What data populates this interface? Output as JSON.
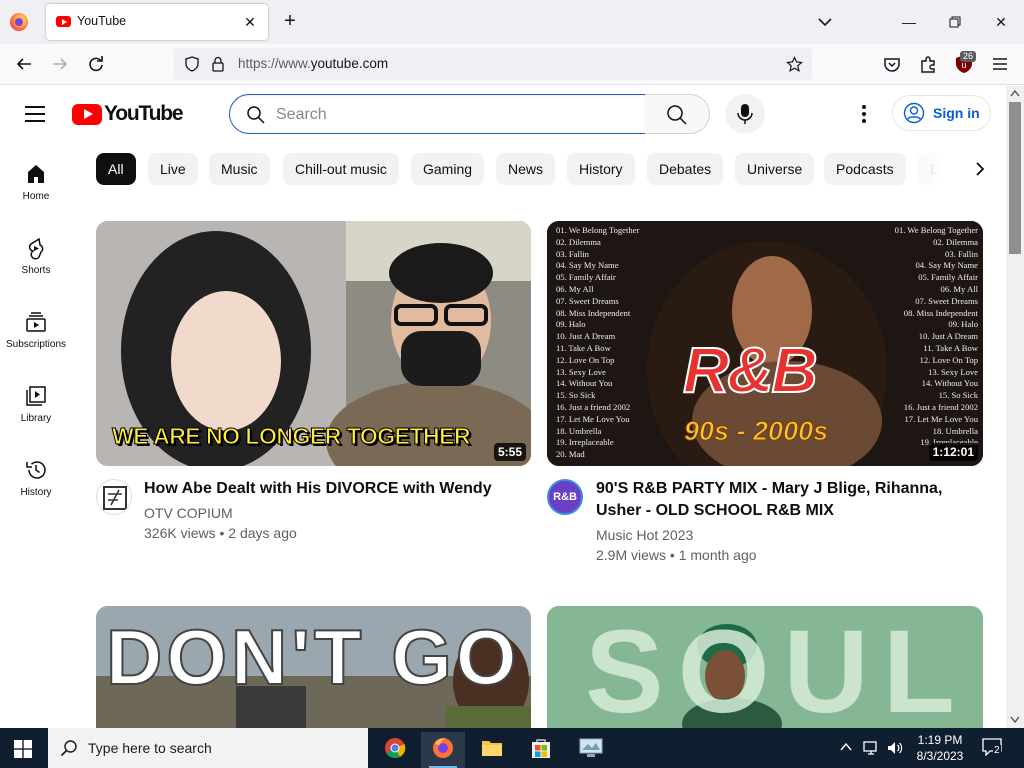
{
  "browser": {
    "tab_title": "YouTube",
    "url_prefix": "https://www.",
    "url_host": "youtube.com",
    "extension_badge": "26"
  },
  "youtube": {
    "logo_text": "YouTube",
    "search_placeholder": "Search",
    "signin_label": "Sign in",
    "chips": [
      "All",
      "Live",
      "Music",
      "Chill-out music",
      "Gaming",
      "News",
      "History",
      "Debates",
      "Universe",
      "Podcasts",
      "D"
    ],
    "guide": [
      "Home",
      "Shorts",
      "Subscriptions",
      "Library",
      "History"
    ],
    "videos": [
      {
        "title": "How Abe Dealt with His DIVORCE with Wendy",
        "channel": "OTV COPIUM",
        "meta": "326K views • 2 days ago",
        "duration": "5:55",
        "thumb_caption": "WE ARE NO LONGER TOGETHER"
      },
      {
        "title_line1": "90'S R&B PARTY MIX - Mary J Blige, Rihanna,",
        "title_line2": "Usher - OLD SCHOOL R&B MIX",
        "channel": "Music Hot 2023",
        "meta": "2.9M views • 1 month ago",
        "duration": "1:12:01",
        "avatar_text": "R&B",
        "thumb_big": "R&B",
        "thumb_sub": "90s - 2000s",
        "tracklist": [
          "01. We Belong Together",
          "02. Dilemma",
          "03. Fallin",
          "04. Say My Name",
          "05. Family Affair",
          "06. My All",
          "07. Sweet Dreams",
          "08. Miss Independent",
          "09. Halo",
          "10. Just A Dream",
          "11. Take A Bow",
          "12. Love On Top",
          "13. Sexy Love",
          "14. Without You",
          "15. So Sick",
          "16. Just a friend 2002",
          "17. Let Me Love You",
          "18. Umbrella",
          "19. Irreplaceable",
          "20. Mad"
        ]
      },
      {
        "thumb_text": "DON'T GO"
      },
      {
        "thumb_text": "SOUL"
      }
    ]
  },
  "taskbar": {
    "search_text": "Type here to search",
    "time": "1:19 PM",
    "date": "8/3/2023",
    "notifications": "2"
  }
}
